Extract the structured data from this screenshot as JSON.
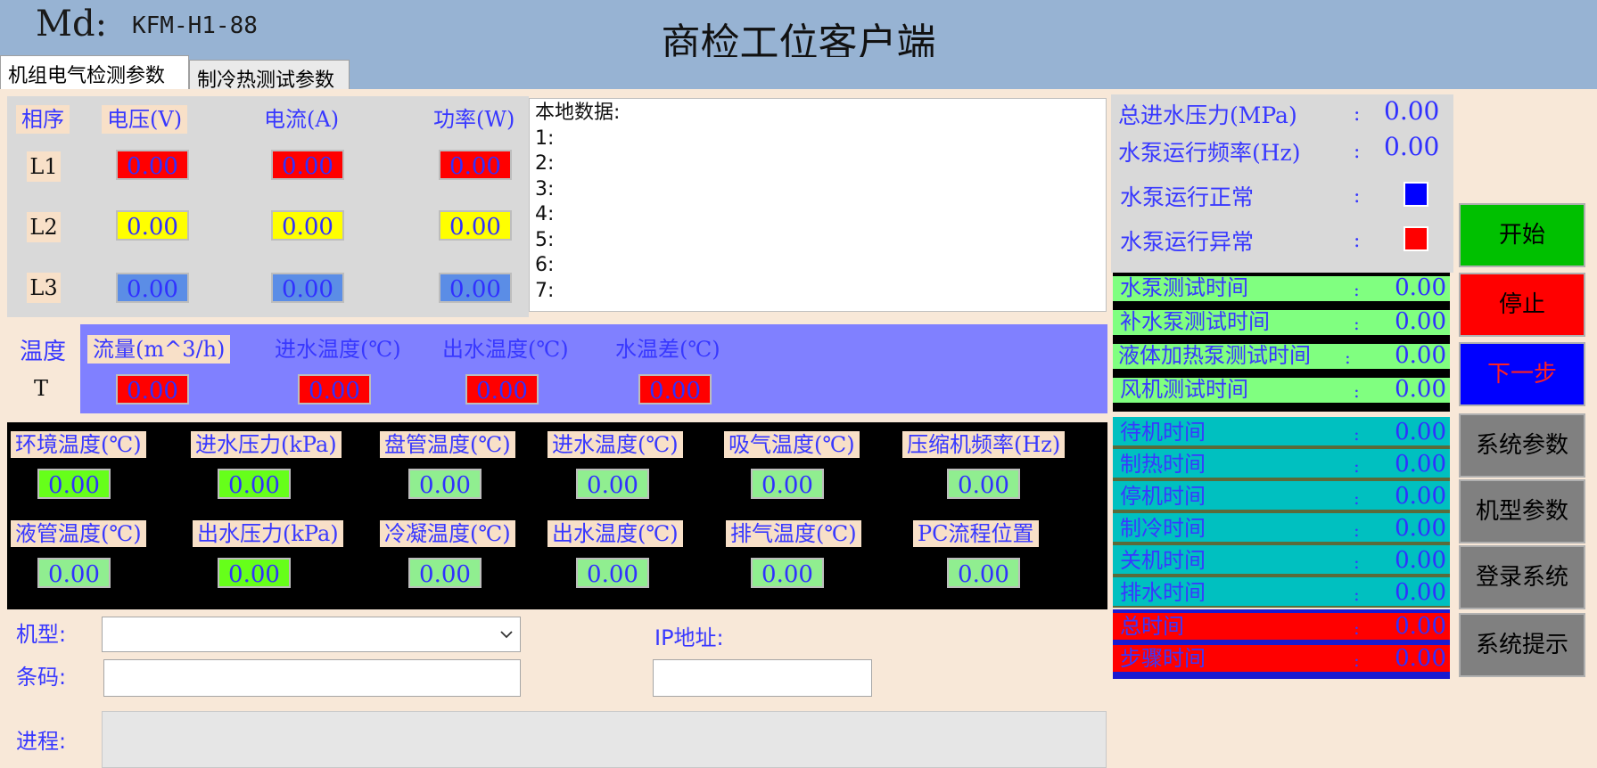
{
  "header": {
    "md_label": "Md:",
    "md_value": "KFM-H1-88",
    "title": "商检工位客户端"
  },
  "tabs": [
    {
      "label": "机组电气检测参数"
    },
    {
      "label": "制冷热测试参数"
    }
  ],
  "electrical": {
    "headers": {
      "phase": "相序",
      "voltage": "电压(V)",
      "current": "电流(A)",
      "power": "功率(W)"
    },
    "rows": [
      {
        "phase": "L1",
        "voltage": "0.00",
        "current": "0.00",
        "power": "0.00",
        "color": "#ff0000"
      },
      {
        "phase": "L2",
        "voltage": "0.00",
        "current": "0.00",
        "power": "0.00",
        "color": "#ffff00"
      },
      {
        "phase": "L3",
        "voltage": "0.00",
        "current": "0.00",
        "power": "0.00",
        "color": "#5b8de6"
      }
    ]
  },
  "local_log": {
    "title": "本地数据:",
    "lines": [
      "1:",
      "2:",
      "3:",
      "4:",
      "5:",
      "6:",
      "7:"
    ]
  },
  "temperature": {
    "label": "温度",
    "row_label": "T",
    "headers": {
      "flow": "流量(m^3/h)",
      "inlet": "进水温度(℃)",
      "outlet": "出水温度(℃)",
      "diff": "水温差(℃)"
    },
    "values": {
      "flow": "0.00",
      "inlet": "0.00",
      "outlet": "0.00",
      "diff": "0.00"
    }
  },
  "sensors": {
    "row1": [
      {
        "label": "环境温度(℃)",
        "value": "0.00",
        "highlight": true
      },
      {
        "label": "进水压力(kPa)",
        "value": "0.00",
        "highlight": true
      },
      {
        "label": "盘管温度(℃)",
        "value": "0.00",
        "highlight": false
      },
      {
        "label": "进水温度(℃)",
        "value": "0.00",
        "highlight": false
      },
      {
        "label": "吸气温度(℃)",
        "value": "0.00",
        "highlight": false
      },
      {
        "label": "压缩机频率(Hz)",
        "value": "0.00",
        "highlight": false
      }
    ],
    "row2": [
      {
        "label": "液管温度(℃)",
        "value": "0.00",
        "highlight": false
      },
      {
        "label": "出水压力(kPa)",
        "value": "0.00",
        "highlight": true
      },
      {
        "label": "冷凝温度(℃)",
        "value": "0.00",
        "highlight": false
      },
      {
        "label": "出水温度(℃)",
        "value": "0.00",
        "highlight": false
      },
      {
        "label": "排气温度(℃)",
        "value": "0.00",
        "highlight": false
      },
      {
        "label": "PC流程位置",
        "value": "0.00",
        "highlight": false
      }
    ]
  },
  "form": {
    "model_label": "机型:",
    "barcode_label": "条码:",
    "ip_label": "IP地址:",
    "progress_label": "进程:",
    "model_value": "",
    "barcode_value": "",
    "ip_value": "",
    "progress_value": ""
  },
  "status": {
    "total_pressure_label": "总进水压力(MPa)",
    "total_pressure_value": "0.00",
    "pump_freq_label": "水泵运行频率(Hz)",
    "pump_freq_value": "0.00",
    "pump_ok_label": "水泵运行正常",
    "pump_ok_color": "#0000ff",
    "pump_err_label": "水泵运行异常",
    "pump_err_color": "#ff0000",
    "colon": ":"
  },
  "timers_green": [
    {
      "label": "水泵测试时间",
      "value": "0.00"
    },
    {
      "label": "补水泵测试时间",
      "value": "0.00"
    },
    {
      "label": "液体加热泵测试时间",
      "value": "0.00"
    },
    {
      "label": "风机测试时间",
      "value": "0.00"
    }
  ],
  "timers_teal": [
    {
      "label": "待机时间",
      "value": "0.00"
    },
    {
      "label": "制热时间",
      "value": "0.00"
    },
    {
      "label": "停机时间",
      "value": "0.00"
    },
    {
      "label": "制冷时间",
      "value": "0.00"
    },
    {
      "label": "关机时间",
      "value": "0.00"
    },
    {
      "label": "排水时间",
      "value": "0.00"
    }
  ],
  "timers_red": [
    {
      "label": "总时间",
      "value": "0.00"
    },
    {
      "label": "步骤时间",
      "value": "0.00"
    }
  ],
  "buttons": {
    "start": "开始",
    "stop": "停止",
    "next": "下一步",
    "sys_params": "系统参数",
    "model_params": "机型参数",
    "login": "登录系统",
    "sys_hint": "系统提示"
  },
  "colors": {
    "header_bg": "#97b3d3",
    "start_bg": "#00c000",
    "stop_bg": "#ff0000",
    "next_bg": "#0000ff",
    "timer_green": "#80ff80",
    "timer_teal": "#00c0c0",
    "timer_red": "#ff0000"
  }
}
